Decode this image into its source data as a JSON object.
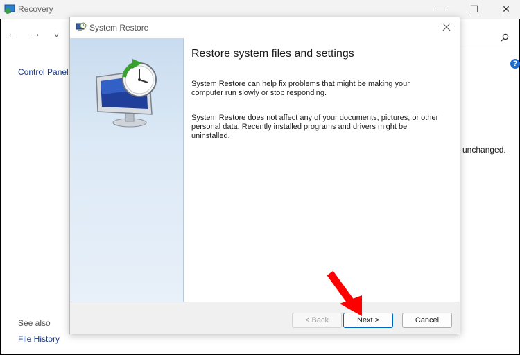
{
  "background_window": {
    "title": "Recovery",
    "nav": {
      "back_glyph": "←",
      "forward_glyph": "→",
      "dropdown_glyph": "˅"
    },
    "window_controls": {
      "minimize": "—",
      "maximize": "☐",
      "close": "✕"
    },
    "sidebar_link": "Control Panel",
    "help_glyph": "?",
    "partial_text": "unchanged.",
    "see_also_label": "See also",
    "file_history_link": "File History"
  },
  "dialog": {
    "title": "System Restore",
    "heading": "Restore system files and settings",
    "paragraph1": "System Restore can help fix problems that might be making your computer run slowly or stop responding.",
    "paragraph2": "System Restore does not affect any of your documents, pictures, or other personal data. Recently installed programs and drivers might be uninstalled.",
    "buttons": {
      "back": "< Back",
      "next": "Next >",
      "cancel": "Cancel"
    }
  },
  "colors": {
    "accent": "#0067c0",
    "annotation_arrow": "#ff0000",
    "side_panel": "#d6e4f2"
  },
  "icons": [
    "recovery-app-icon",
    "search-icon",
    "help-icon",
    "system-restore-icon",
    "close-icon",
    "restore-monitor-clock-icon",
    "red-arrow-annotation"
  ]
}
